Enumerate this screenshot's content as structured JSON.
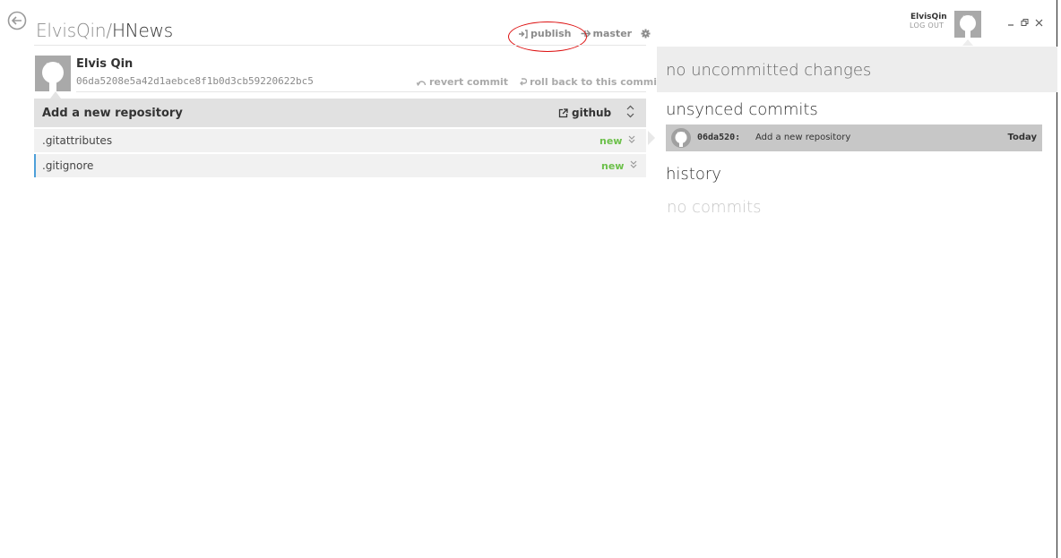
{
  "header": {
    "owner": "ElvisQin",
    "separator": "/",
    "repo": "HNews",
    "publish_label": "publish",
    "branch_label": "master"
  },
  "commit": {
    "author": "Elvis Qin",
    "sha": "06da5208e5a42d1aebce8f1b0d3cb59220622bc5",
    "revert_label": "revert commit",
    "rollback_label": "roll back to this commit",
    "message": "Add a new repository",
    "github_label": "github"
  },
  "files": [
    {
      "name": ".gitattributes",
      "status": "new"
    },
    {
      "name": ".gitignore",
      "status": "new"
    }
  ],
  "account": {
    "name": "ElvisQin",
    "logout_label": "LOG OUT"
  },
  "changes": {
    "uncommitted_text": "no uncommitted changes",
    "unsynced_heading": "unsynced commits",
    "unsynced": [
      {
        "sha": "06da520:",
        "message": "Add a new repository",
        "date": "Today"
      }
    ],
    "history_heading": "history",
    "history_empty": "no commits"
  },
  "colors": {
    "accent_selected": "#4ea0d9",
    "status_new": "#6cc04a",
    "annotation_circle": "#dd1111"
  }
}
